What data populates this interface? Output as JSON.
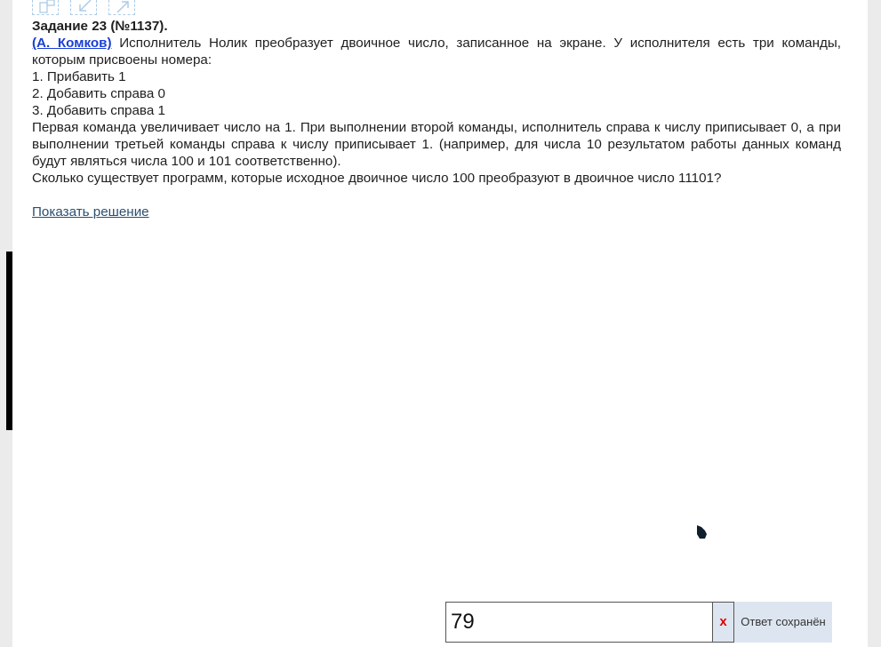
{
  "task": {
    "title": "Задание 23 (№1137).",
    "author": "(А. Комков)",
    "intro": " Исполнитель Нолик преобразует двоичное число, записанное на экране. У исполнителя есть три команды, которым присвоены номера:",
    "commands": [
      "1. Прибавить 1",
      "2. Добавить справа 0",
      "3. Добавить справа 1"
    ],
    "explanation": "Первая команда увеличивает число на 1. При выполнении второй команды, исполнитель справа к числу приписывает 0, а при выполнении третьей команды справа к числу приписывает 1. (например, для числа 10 результатом работы данных команд будут являться числа 100 и 101 соответственно).",
    "question": "Сколько существует программ, которые исходное двоичное число 100 преобразуют в двоичное число 11101?",
    "show_solution": "Показать решение"
  },
  "answer": {
    "value": "79",
    "clear_label": "x",
    "status": "Ответ сохранён"
  },
  "toolbar": {
    "icons": [
      "fullscreen-icon",
      "collapse-icon",
      "expand-icon"
    ]
  }
}
